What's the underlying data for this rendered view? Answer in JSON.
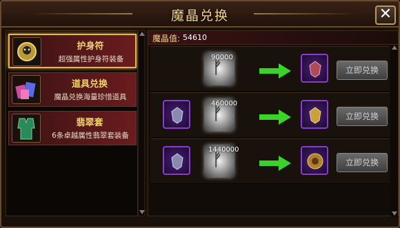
{
  "window": {
    "title": "魔晶兑换",
    "close_glyph": "✕"
  },
  "crystal": {
    "label": "魔晶值:",
    "value": "54610"
  },
  "sidebar": {
    "items": [
      {
        "title": "护身符",
        "desc": "超强属性护身符装备",
        "icon": "amulet-icon",
        "selected": true
      },
      {
        "title": "道具兑换",
        "desc": "魔晶兑换海量珍惜道具",
        "icon": "gems-icon",
        "selected": false
      },
      {
        "title": "翡翠套",
        "desc": "6条卓越属性翡翠套装备",
        "icon": "armor-icon",
        "selected": false
      }
    ]
  },
  "exchanges": [
    {
      "cost": "90000",
      "button": "立即兑换",
      "has_input": false
    },
    {
      "cost": "460000",
      "button": "立即兑换",
      "has_input": true
    },
    {
      "cost": "1440000",
      "button": "立即兑换",
      "has_input": true
    }
  ],
  "colors": {
    "accent": "#f1d48a",
    "slot": "#8a3bd0",
    "arrow": "#3bd22a"
  }
}
